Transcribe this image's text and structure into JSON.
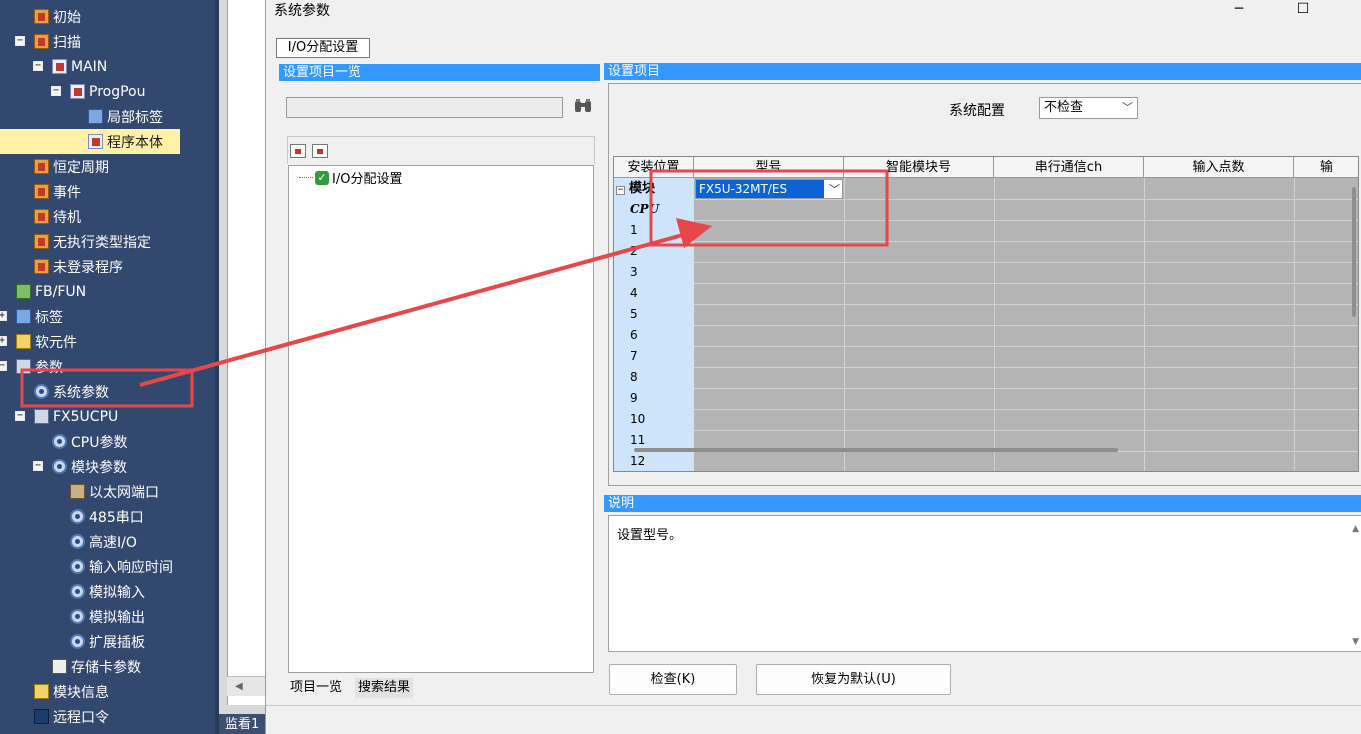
{
  "nav": {
    "items": [
      {
        "label": "初始",
        "icon": "folder-icon"
      },
      {
        "label": "扫描",
        "icon": "folder-icon",
        "toggle": "−"
      },
      {
        "label": "MAIN",
        "icon": "program-icon",
        "toggle": "−"
      },
      {
        "label": "ProgPou",
        "icon": "program-icon",
        "toggle": "−"
      },
      {
        "label": "局部标签",
        "icon": "label-icon"
      },
      {
        "label": "程序本体",
        "icon": "program-icon"
      },
      {
        "label": "恒定周期",
        "icon": "folder-icon"
      },
      {
        "label": "事件",
        "icon": "folder-icon"
      },
      {
        "label": "待机",
        "icon": "folder-icon"
      },
      {
        "label": "无执行类型指定",
        "icon": "folder-icon"
      },
      {
        "label": "未登录程序",
        "icon": "folder-icon"
      },
      {
        "label": "FB/FUN",
        "icon": "fb-icon"
      },
      {
        "label": "标签",
        "icon": "label-icon",
        "toggle": "+"
      },
      {
        "label": "软元件",
        "icon": "device-icon",
        "toggle": "+"
      },
      {
        "label": "参数",
        "icon": "parameter-icon",
        "toggle": "−"
      },
      {
        "label": "系统参数",
        "icon": "gear-icon"
      },
      {
        "label": "FX5UCPU",
        "icon": "parameter-icon",
        "toggle": "−"
      },
      {
        "label": "CPU参数",
        "icon": "gear-icon"
      },
      {
        "label": "模块参数",
        "icon": "gear-icon",
        "toggle": "−"
      },
      {
        "label": "以太网端口",
        "icon": "network-icon"
      },
      {
        "label": "485串口",
        "icon": "gear-icon"
      },
      {
        "label": "高速I/O",
        "icon": "gear-icon"
      },
      {
        "label": "输入响应时间",
        "icon": "gear-icon"
      },
      {
        "label": "模拟输入",
        "icon": "gear-icon"
      },
      {
        "label": "模拟输出",
        "icon": "gear-icon"
      },
      {
        "label": "扩展插板",
        "icon": "gear-icon"
      },
      {
        "label": "存储卡参数",
        "icon": "memory-card-icon"
      },
      {
        "label": "模块信息",
        "icon": "module-icon"
      },
      {
        "label": "远程口令",
        "icon": "lock-icon"
      }
    ]
  },
  "middle": {
    "bottom_label": "监看1"
  },
  "dialog": {
    "title": "系统参数",
    "tab_label": "I/O分配设置",
    "left_panel": {
      "header": "设置项目一览",
      "tree_item": "I/O分配设置",
      "tabs": [
        "项目一览",
        "搜索结果"
      ]
    },
    "right_panel": {
      "header": "设置项目",
      "system_config_label": "系统配置",
      "system_config_value": "不检查",
      "columns": [
        "安装位置",
        "型号",
        "智能模块号",
        "串行通信ch",
        "输入点数",
        "输"
      ],
      "rows": [
        "模块",
        "CPU",
        "1",
        "2",
        "3",
        "4",
        "5",
        "6",
        "7",
        "8",
        "9",
        "10",
        "11",
        "12"
      ],
      "model_value": "FX5U-32MT/ES",
      "description_header": "说明",
      "description_text": "设置型号。",
      "buttons": {
        "check": "检查(K)",
        "restore": "恢复为默认(U)"
      }
    }
  },
  "colors": {
    "nav_bg": "#33486e",
    "header_blue": "#3399ff",
    "selected_row": "#fff2a8",
    "annotation_red": "#e8474a",
    "selected_value": "#0a64d6"
  }
}
